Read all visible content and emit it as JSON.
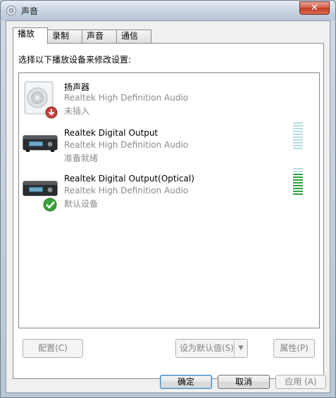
{
  "window": {
    "title": "声音"
  },
  "tabs": [
    {
      "label": "播放"
    },
    {
      "label": "录制"
    },
    {
      "label": "声音"
    },
    {
      "label": "通信"
    }
  ],
  "panel": {
    "instruction": "选择以下播放设备来修改设置:",
    "devices": [
      {
        "name": "扬声器",
        "driver": "Realtek High Definition Audio",
        "status": "未插入",
        "icon": "speaker-icon",
        "badge": "unplugged-badge-icon"
      },
      {
        "name": "Realtek Digital Output",
        "driver": "Realtek High Definition Audio",
        "status": "准备就绪",
        "icon": "digital-output-device-icon",
        "meter_level": 0
      },
      {
        "name": "Realtek Digital Output(Optical)",
        "driver": "Realtek High Definition Audio",
        "status": "默认设备",
        "icon": "digital-output-device-icon",
        "badge": "default-checkmark-icon",
        "meter_level": 0.8
      }
    ]
  },
  "buttons": {
    "configure": "配置(C)",
    "set_default": "设为默认值(S)",
    "properties": "属性(P)",
    "ok": "确定",
    "cancel": "取消",
    "apply": "应用 (A)"
  },
  "colors": {
    "meter_idle": "#b7dde3",
    "meter_active": "#2aa43a",
    "close_button": "#c23c24"
  }
}
